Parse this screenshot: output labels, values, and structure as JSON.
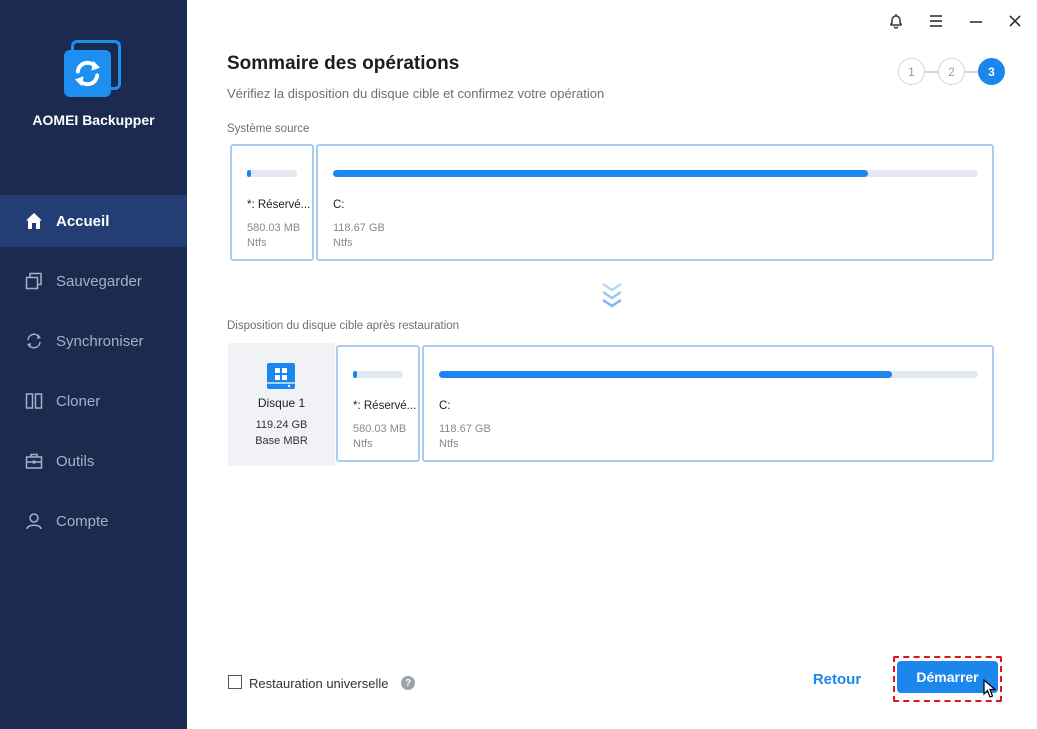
{
  "app": {
    "name": "AOMEI Backupper"
  },
  "sidebar": {
    "items": [
      {
        "label": "Accueil",
        "icon": "home-icon",
        "active": true
      },
      {
        "label": "Sauvegarder",
        "icon": "backup-icon",
        "active": false
      },
      {
        "label": "Synchroniser",
        "icon": "sync-icon",
        "active": false
      },
      {
        "label": "Cloner",
        "icon": "clone-icon",
        "active": false
      },
      {
        "label": "Outils",
        "icon": "tools-icon",
        "active": false
      },
      {
        "label": "Compte",
        "icon": "user-icon",
        "active": false
      }
    ]
  },
  "window_controls": [
    "bell-icon",
    "menu-icon",
    "minimize-icon",
    "close-icon"
  ],
  "main": {
    "title": "Sommaire des opérations",
    "subtitle": "Vérifiez la disposition du disque cible et confirmez votre opération",
    "steps": [
      "1",
      "2",
      "3"
    ],
    "active_step": 3,
    "source": {
      "label": "Système source",
      "partitions": [
        {
          "name": "*: Réservé...",
          "size": "580.03 MB",
          "fs": "Ntfs",
          "used_fraction": 0.05
        },
        {
          "name": "C:",
          "size": "118.67 GB",
          "fs": "Ntfs",
          "used_fraction": 0.83
        }
      ]
    },
    "target": {
      "label": "Disposition du disque cible après restauration",
      "disk": {
        "name": "Disque 1",
        "size": "119.24 GB",
        "type": "Base MBR"
      },
      "partitions": [
        {
          "name": "*: Réservé...",
          "size": "580.03 MB",
          "fs": "Ntfs",
          "used_fraction": 0.05
        },
        {
          "name": "C:",
          "size": "118.67 GB",
          "fs": "Ntfs",
          "used_fraction": 0.84
        }
      ]
    }
  },
  "footer": {
    "universal_restore_label": "Restauration universelle",
    "help": "?",
    "back_label": "Retour",
    "start_label": "Démarrer"
  },
  "colors": {
    "sidebar_bg": "#1b2a4e",
    "sidebar_active": "#233e74",
    "accent": "#1b86ec",
    "highlight": "#e0141e"
  }
}
